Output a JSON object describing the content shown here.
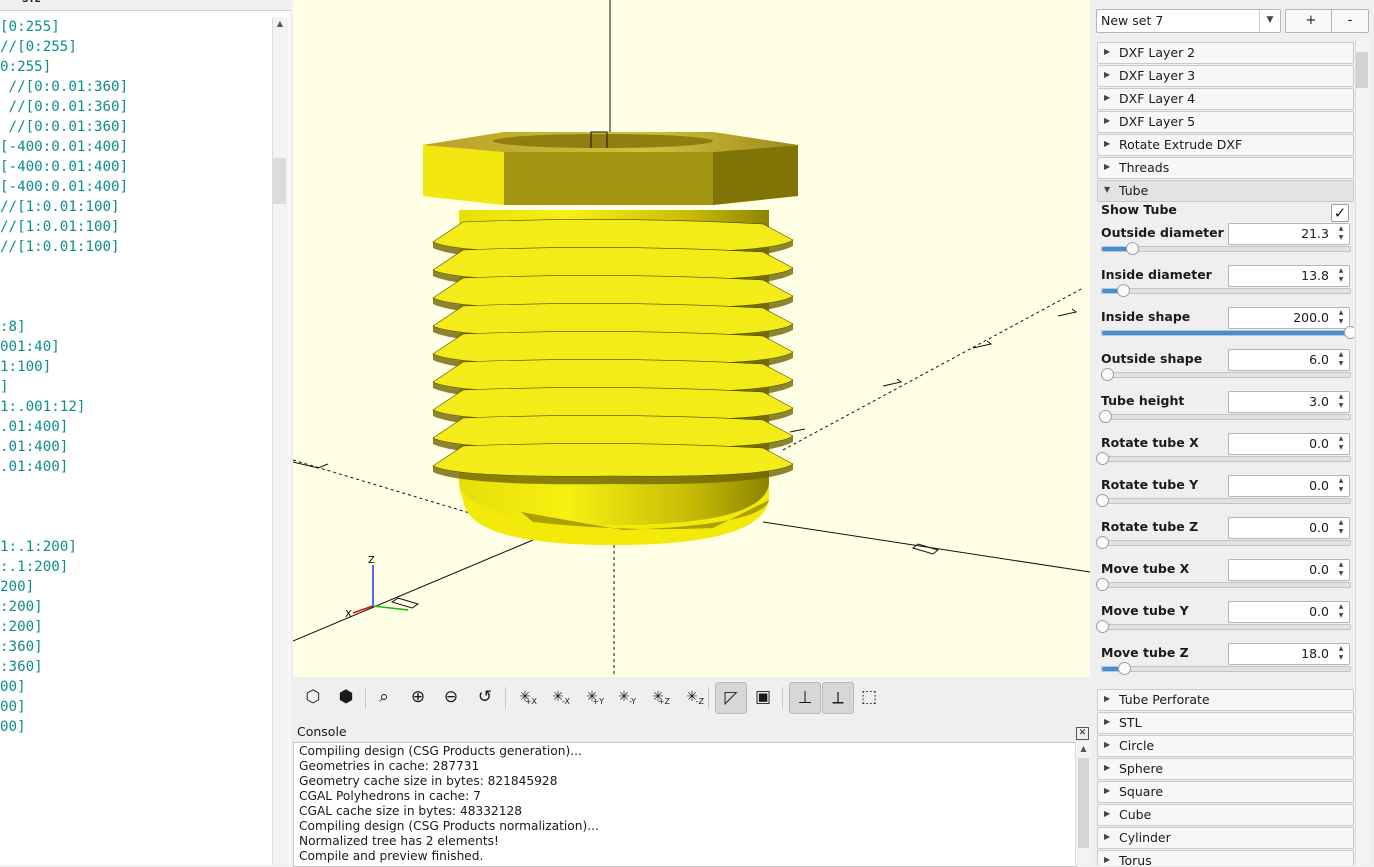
{
  "editor": {
    "lines": [
      "[0:255]",
      "//[0:255]",
      "0:255]",
      " //[0:0.01:360]",
      " //[0:0.01:360]",
      " //[0:0.01:360]",
      "[-400:0.01:400]",
      "[-400:0.01:400]",
      "[-400:0.01:400]",
      "//[1:0.01:100]",
      "//[1:0.01:100]",
      "//[1:0.01:100]",
      "",
      "",
      "",
      ":8]",
      "001:40]",
      "1:100]",
      "]",
      "1:.001:12]",
      ".01:400]",
      ".01:400]",
      ".01:400]",
      "",
      "",
      "",
      "1:.1:200]",
      ":.1:200]",
      "200]",
      ":200]",
      ":200]",
      ":360]",
      ":360]",
      "00]",
      "00]",
      "00]"
    ]
  },
  "viewport": {
    "axis_labels": {
      "z": "Z",
      "x": "X"
    },
    "part_color": "#f2ea0a",
    "background": "#ffffe6"
  },
  "toolbar": {
    "buttons": [
      {
        "name": "preview-icon",
        "active": false
      },
      {
        "name": "render-icon",
        "active": false
      },
      {
        "name": "view-all-icon",
        "active": false
      },
      {
        "name": "zoom-in-icon",
        "active": false
      },
      {
        "name": "zoom-out-icon",
        "active": false
      },
      {
        "name": "reset-view-icon",
        "active": false
      },
      {
        "name": "view-right-icon",
        "label": "+X",
        "active": false
      },
      {
        "name": "view-left-icon",
        "label": "-X",
        "active": false
      },
      {
        "name": "view-back-icon",
        "label": "+Y",
        "active": false
      },
      {
        "name": "view-front-icon",
        "label": "-Y",
        "active": false
      },
      {
        "name": "view-top-icon",
        "label": "+Z",
        "active": false
      },
      {
        "name": "view-bottom-icon",
        "label": "-Z",
        "active": false
      },
      {
        "name": "perspective-icon",
        "active": true
      },
      {
        "name": "orthogonal-icon",
        "active": false
      },
      {
        "name": "show-axes-icon",
        "active": true
      },
      {
        "name": "show-scale-markers-icon",
        "active": true
      },
      {
        "name": "show-edges-icon",
        "active": false
      }
    ]
  },
  "console": {
    "title": "Console",
    "lines": [
      "Compiling design (CSG Products generation)...",
      "Geometries in cache: 287731",
      "Geometry cache size in bytes: 821845928",
      "CGAL Polyhedrons in cache: 7",
      "CGAL cache size in bytes: 48332128",
      "Compiling design (CSG Products normalization)...",
      "Normalized tree has 2 elements!",
      "Compile and preview finished."
    ]
  },
  "customizer": {
    "preset": "New set 7",
    "add_label": "+",
    "remove_label": "-",
    "groups_before": [
      "DXF Layer 2",
      "DXF Layer 3",
      "DXF Layer 4",
      "DXF Layer 5",
      "Rotate Extrude DXF",
      "Threads"
    ],
    "open_group": "Tube",
    "show_tube": {
      "label": "Show Tube",
      "checked": true,
      "mark": "✓"
    },
    "params": [
      {
        "label": "Outside diameter",
        "value": "21.3",
        "fraction": 0.12
      },
      {
        "label": "Inside diameter",
        "value": "13.8",
        "fraction": 0.085
      },
      {
        "label": "Inside shape",
        "value": "200.0",
        "fraction": 1.0
      },
      {
        "label": "Outside shape",
        "value": "6.0",
        "fraction": 0.02
      },
      {
        "label": "Tube height",
        "value": "3.0",
        "fraction": 0.012
      },
      {
        "label": "Rotate tube X",
        "value": "0.0",
        "fraction": 0.0
      },
      {
        "label": "Rotate tube Y",
        "value": "0.0",
        "fraction": 0.0
      },
      {
        "label": "Rotate tube Z",
        "value": "0.0",
        "fraction": 0.0
      },
      {
        "label": "Move tube X",
        "value": "0.0",
        "fraction": 0.0
      },
      {
        "label": "Move tube Y",
        "value": "0.0",
        "fraction": 0.0
      },
      {
        "label": "Move tube Z",
        "value": "18.0",
        "fraction": 0.09
      }
    ],
    "groups_after": [
      "Tube Perforate",
      "STL",
      "Circle",
      "Sphere",
      "Square",
      "Cube",
      "Cylinder",
      "Torus"
    ]
  }
}
